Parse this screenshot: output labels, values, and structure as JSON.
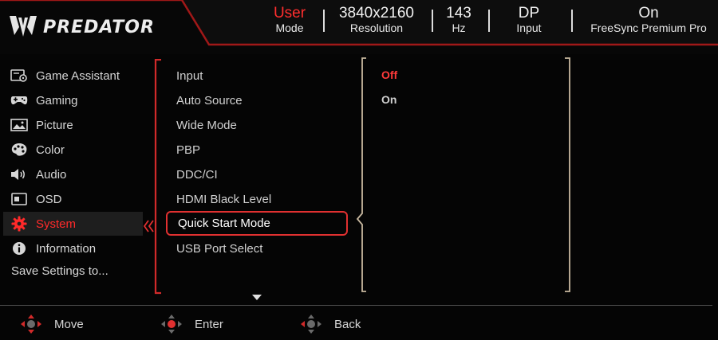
{
  "brand": {
    "name": "PREDATOR"
  },
  "status_bar": [
    {
      "value": "User",
      "label": "Mode"
    },
    {
      "value": "3840x2160",
      "label": "Resolution"
    },
    {
      "value": "143",
      "label": "Hz"
    },
    {
      "value": "DP",
      "label": "Input"
    },
    {
      "value": "On",
      "label": "FreeSync Premium Pro"
    }
  ],
  "sidebar": {
    "items": [
      {
        "label": "Game Assistant",
        "icon": "game-assistant-icon"
      },
      {
        "label": "Gaming",
        "icon": "gamepad-icon"
      },
      {
        "label": "Picture",
        "icon": "picture-icon"
      },
      {
        "label": "Color",
        "icon": "palette-icon"
      },
      {
        "label": "Audio",
        "icon": "speaker-icon"
      },
      {
        "label": "OSD",
        "icon": "osd-icon"
      },
      {
        "label": "System",
        "icon": "gear-icon",
        "active": true
      },
      {
        "label": "Information",
        "icon": "info-icon"
      }
    ],
    "save_label": "Save Settings to..."
  },
  "submenu": {
    "items": [
      "Input",
      "Auto Source",
      "Wide Mode",
      "PBP",
      "DDC/CI",
      "HDMI Black Level",
      "Quick Start Mode",
      "USB Port Select"
    ],
    "selected": "Quick Start Mode"
  },
  "options": {
    "items": [
      "Off",
      "On"
    ],
    "selected": "Off"
  },
  "footer": [
    {
      "label": "Move",
      "icon": "dpad-move-icon"
    },
    {
      "label": "Enter",
      "icon": "dpad-enter-icon"
    },
    {
      "label": "Back",
      "icon": "dpad-back-icon"
    }
  ],
  "colors": {
    "accent": "#e03030",
    "background": "#050505",
    "text": "#d6d6d6"
  }
}
